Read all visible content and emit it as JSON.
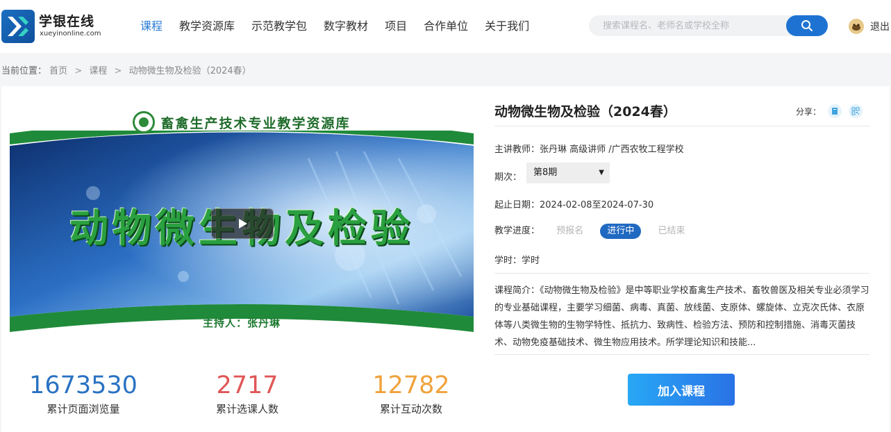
{
  "header": {
    "logo_cn": "学银在线",
    "logo_en": "xueyinonline.com",
    "nav": [
      {
        "label": "课程",
        "active": true
      },
      {
        "label": "教学资源库",
        "active": false
      },
      {
        "label": "示范教学包",
        "active": false
      },
      {
        "label": "数字教材",
        "active": false
      },
      {
        "label": "项目",
        "active": false
      },
      {
        "label": "合作单位",
        "active": false
      },
      {
        "label": "关于我们",
        "active": false
      }
    ],
    "search_placeholder": "搜索课程名、老师名或学校全称",
    "search_icon": "search-icon",
    "logout_label": "退出"
  },
  "breadcrumb": {
    "label": "当前位置：",
    "items": [
      "首页",
      "课程",
      "动物微生物及检验（2024春）"
    ],
    "separator": ">"
  },
  "cover": {
    "header_text": "畜禽生产技术专业教学资源库",
    "title": "动物微生物及检验",
    "host": "主持人：张丹琳",
    "play_icon": "play-icon"
  },
  "stats": [
    {
      "value": "1673530",
      "label": "累计页面浏览量",
      "color": "#2a72c2"
    },
    {
      "value": "2717",
      "label": "累计选课人数",
      "color": "#e05656"
    },
    {
      "value": "12782",
      "label": "累计互动次数",
      "color": "#f0a23c"
    }
  ],
  "course": {
    "title": "动物微生物及检验（2024春）",
    "share_label": "分享：",
    "teacher_label": "主讲教师：",
    "teacher_value": "张丹琳 高级讲师 /广西农牧工程学校",
    "term_label": "期次：",
    "term_value": "第8期",
    "dates_label": "起止日期：",
    "dates_value": "2024-02-08至2024-07-30",
    "progress_label": "教学进度：",
    "progress_steps": [
      {
        "label": "预报名",
        "active": false
      },
      {
        "label": "进行中",
        "active": true
      },
      {
        "label": "已结束",
        "active": false
      }
    ],
    "hours_label": "学时：",
    "hours_value": "学时",
    "intro_label": "课程简介：",
    "intro_text": "《动物微生物及检验》是中等职业学校畜禽生产技术、畜牧兽医及相关专业必须学习的专业基础课程，主要学习细菌、病毒、真菌、放线菌、支原体、螺旋体、立克次氏体、衣原体等八类微生物的生物学特性、抵抗力、致病性、检验方法、预防和控制措施、消毒灭菌技术、动物免疫基础技术、微生物应用技术。所学理论知识和技能...",
    "join_label": "加入课程"
  },
  "colors": {
    "accent": "#1e73d2",
    "nav_active": "#2a7bd4",
    "progress_active": "#2069c1"
  }
}
